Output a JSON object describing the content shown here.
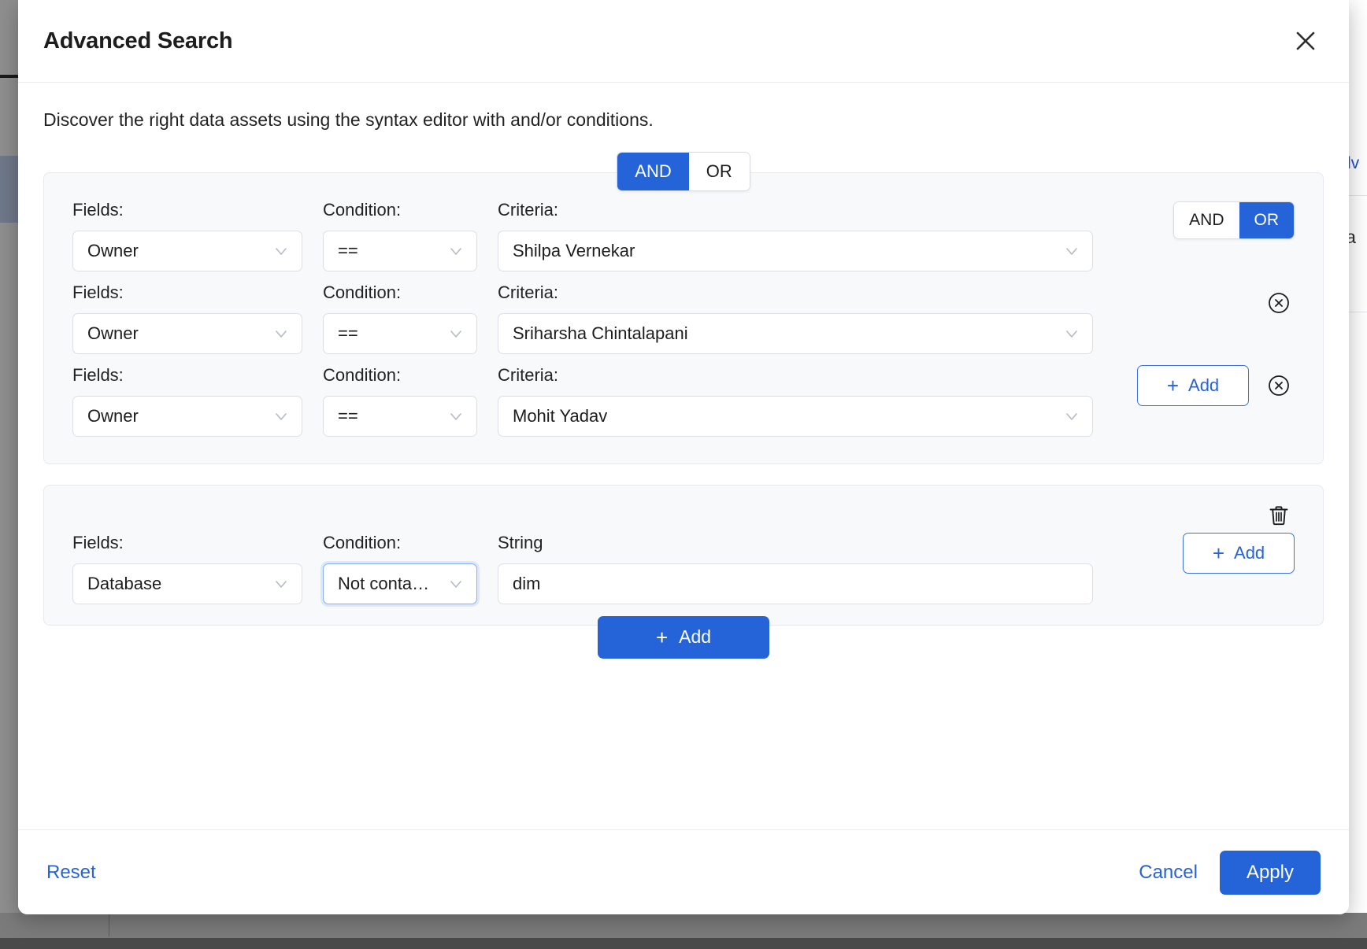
{
  "modal": {
    "title": "Advanced Search",
    "close_icon": "close-icon",
    "description": "Discover the right data assets using the syntax editor with and/or conditions."
  },
  "top_toggle": {
    "and_label": "AND",
    "or_label": "OR",
    "selected": "AND"
  },
  "labels": {
    "fields": "Fields:",
    "condition": "Condition:",
    "criteria": "Criteria:",
    "string": "String"
  },
  "groups": [
    {
      "name": "group-1",
      "rules": [
        {
          "field": "Owner",
          "condition": "==",
          "criteria": "Shilpa Vernekar",
          "toggle": {
            "and_label": "AND",
            "or_label": "OR",
            "selected": "OR"
          }
        },
        {
          "field": "Owner",
          "condition": "==",
          "criteria": "Sriharsha Chintalapani",
          "remove_icon": "circle-x-icon"
        },
        {
          "field": "Owner",
          "condition": "==",
          "criteria": "Mohit Yadav",
          "add_label": "Add",
          "remove_icon": "circle-x-icon"
        }
      ]
    },
    {
      "name": "group-2",
      "delete_icon": "trash-icon",
      "rules": [
        {
          "field": "Database",
          "condition": "Not conta…",
          "condition_focused": true,
          "value": "dim",
          "add_label": "Add"
        }
      ],
      "add_group_label": "Add"
    }
  ],
  "footer": {
    "reset_label": "Reset",
    "cancel_label": "Cancel",
    "apply_label": "Apply"
  },
  "background": {
    "right_link_fragment": "dv",
    "right_text_fragment": "la"
  },
  "colors": {
    "accent": "#2563d9",
    "modal_bg": "#ffffff",
    "group_bg": "#f8f9fb",
    "text": "#1d1d1d"
  }
}
